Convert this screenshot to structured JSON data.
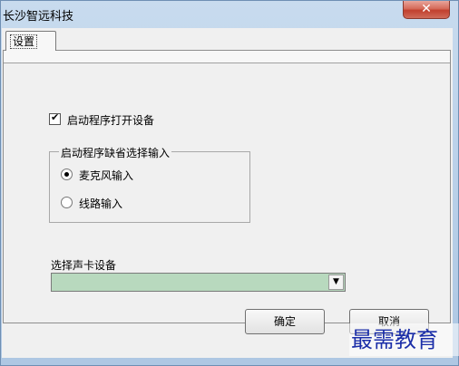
{
  "window": {
    "title": "长沙智远科技",
    "close_glyph": "✕"
  },
  "tabs": [
    {
      "label": "设置",
      "selected": true
    }
  ],
  "settings": {
    "open_device_on_start": {
      "label": "启动程序打开设备",
      "checked": true
    },
    "default_input_group": {
      "title": "启动程序缺省选择输入",
      "options": [
        {
          "label": "麦克风输入",
          "selected": true
        },
        {
          "label": "线路输入",
          "selected": false
        }
      ]
    },
    "sound_card": {
      "label": "选择声卡设备",
      "value": ""
    }
  },
  "buttons": {
    "ok": "确定",
    "cancel": "取消"
  },
  "watermark": {
    "text": "最需教育"
  },
  "colors": {
    "select_background": "#b8d9be",
    "close_button": "#c1402e",
    "watermark": "#1b2ea8"
  }
}
